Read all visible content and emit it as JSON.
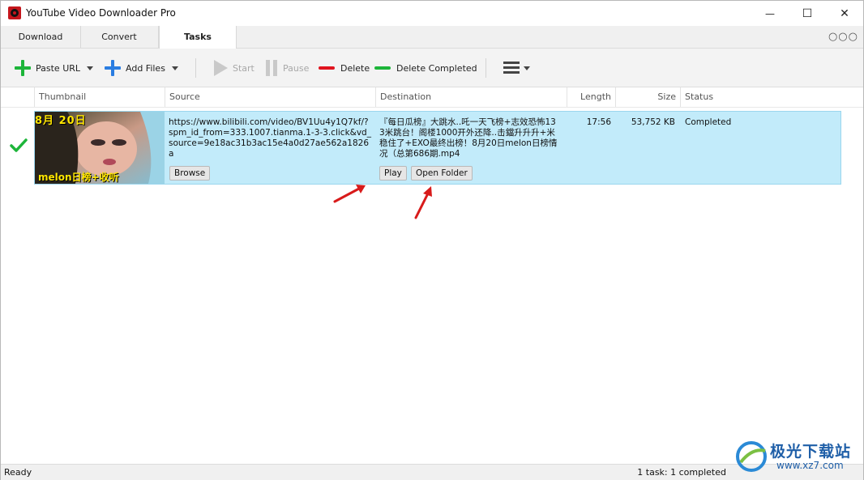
{
  "app": {
    "title": "YouTube Video Downloader Pro"
  },
  "window_controls": {
    "minimize": "—",
    "maximize": "☐",
    "close": "✕"
  },
  "tabs": [
    {
      "label": "Download"
    },
    {
      "label": "Convert"
    },
    {
      "label": "Tasks",
      "active": true
    }
  ],
  "more_menu": "○○○",
  "toolbar": {
    "paste_url": "Paste URL",
    "add_files": "Add Files",
    "start": "Start",
    "pause": "Pause",
    "delete": "Delete",
    "delete_completed": "Delete Completed"
  },
  "table": {
    "columns": [
      "Thumbnail",
      "Source",
      "Destination",
      "Length",
      "Size",
      "Status"
    ],
    "rows": [
      {
        "source": "https://www.bilibili.com/video/BV1Uu4y1Q7kf/?spm_id_from=333.1007.tianma.1-3-3.click&vd_source=9e18ac31b3ac15e4a0d27ae562a1826a",
        "destination": "『每日瓜榜』大跳水..吒一天飞榜+志效恐怖133米跳台！阁楼1000开外还降..击鐺升升升+米稳住了+EXO最终出榜！8月20日melon日榜情况（总第686期.mp4",
        "length": "17:56",
        "size": "53,752 KB",
        "status": "Completed",
        "thumbnail_top_text": "8月 20日",
        "thumbnail_bottom_text": "melon日榜+收听",
        "browse_label": "Browse",
        "play_label": "Play",
        "open_folder_label": "Open Folder"
      }
    ]
  },
  "statusbar": {
    "left": "Ready",
    "right": "1 task: 1 completed"
  },
  "watermark": {
    "name": "极光下载站",
    "url": "www.xz7.com"
  },
  "colors": {
    "row_selected": "#c2ebfa",
    "check_green": "#1db53a",
    "delete_red": "#e0141e",
    "delete_completed_green": "#1db53a",
    "add_blue": "#2a7de1",
    "arrow_red": "#d81b1b"
  }
}
